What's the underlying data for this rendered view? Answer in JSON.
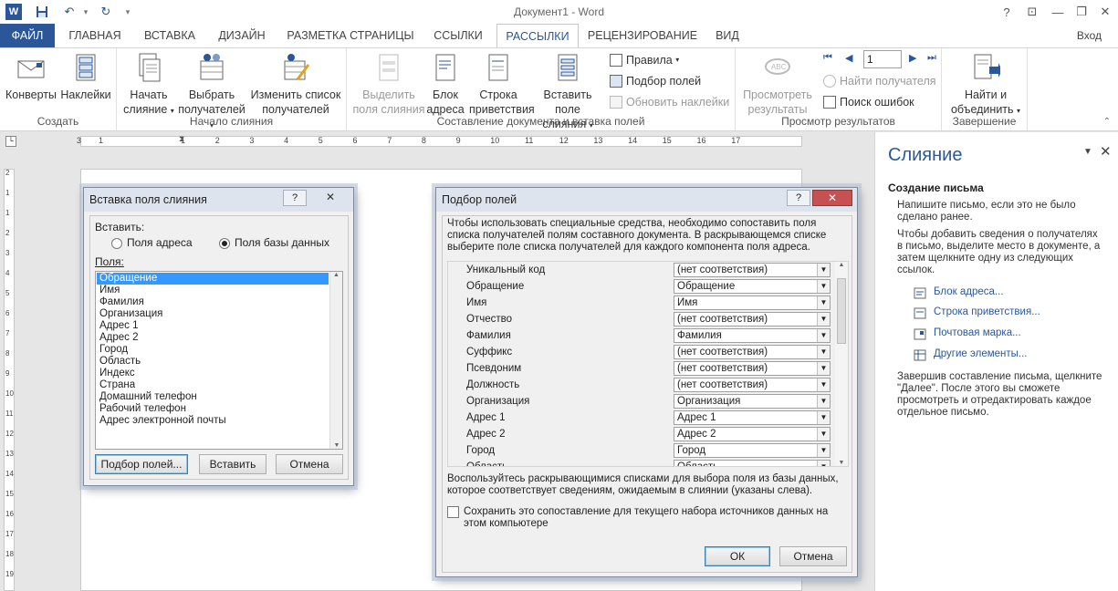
{
  "title_bar": {
    "title": "Документ1 - Word",
    "help": "?",
    "minimize": "—",
    "restore": "❐",
    "close": "✕"
  },
  "tabs": [
    "ФАЙЛ",
    "ГЛАВНАЯ",
    "ВСТАВКА",
    "ДИЗАЙН",
    "РАЗМЕТКА СТРАНИЦЫ",
    "ССЫЛКИ",
    "РАССЫЛКИ",
    "РЕЦЕНЗИРОВАНИЕ",
    "ВИД"
  ],
  "active_tab": "РАССЫЛКИ",
  "signin": "Вход",
  "ribbon": {
    "create": {
      "label": "Создать",
      "envelopes": "Конверты",
      "labels": "Наклейки"
    },
    "start": {
      "label": "Начало слияния",
      "start_l1": "Начать",
      "start_l2": "слияние",
      "select_l1": "Выбрать",
      "select_l2": "получателей",
      "edit_l1": "Изменить список",
      "edit_l2": "получателей"
    },
    "write": {
      "label": "Составление документа и вставка полей",
      "highlight_l1": "Выделить",
      "highlight_l2": "поля слияния",
      "address_l1": "Блок",
      "address_l2": "адреса",
      "greeting_l1": "Строка",
      "greeting_l2": "приветствия",
      "insert_l1": "Вставить поле",
      "insert_l2": "слияния",
      "rules": "Правила",
      "match": "Подбор полей",
      "update": "Обновить наклейки"
    },
    "preview": {
      "label": "Просмотр результатов",
      "preview_l1": "Просмотреть",
      "preview_l2": "результаты",
      "record": "1",
      "find": "Найти получателя",
      "errors": "Поиск ошибок"
    },
    "finish": {
      "label": "Завершение",
      "finish_l1": "Найти и",
      "finish_l2": "объединить"
    }
  },
  "ruler": {
    "ticks": [
      "3",
      "1",
      "1",
      "2",
      "3",
      "4",
      "5",
      "6",
      "7",
      "8",
      "9",
      "10",
      "11",
      "12",
      "13",
      "14",
      "15",
      "16",
      "17"
    ]
  },
  "vruler": {
    "ticks": [
      "2",
      "1",
      "1",
      "2",
      "3",
      "4",
      "5",
      "6",
      "7",
      "8",
      "9",
      "10",
      "11",
      "12",
      "13",
      "14",
      "15",
      "16",
      "17",
      "18",
      "19"
    ]
  },
  "insert_dialog": {
    "title": "Вставка поля слияния",
    "help": "?",
    "close": "✕",
    "insert_label": "Вставить:",
    "radio_address": "Поля адреса",
    "radio_db": "Поля базы данных",
    "fields_label": "Поля:",
    "fields": [
      "Обращение",
      "Имя",
      "Фамилия",
      "Организация",
      "Адрес 1",
      "Адрес 2",
      "Город",
      "Область",
      "Индекс",
      "Страна",
      "Домашний телефон",
      "Рабочий телефон",
      "Адрес электронной почты"
    ],
    "btn_match": "Подбор полей...",
    "btn_insert": "Вставить",
    "btn_cancel": "Отмена"
  },
  "match_dialog": {
    "title": "Подбор полей",
    "help": "?",
    "close": "✕",
    "intro_l1": "Чтобы использовать специальные средства, необходимо сопоставить поля",
    "intro_l2": "списка получателей полям составного документа. В раскрывающемся списке",
    "intro_l3": "выберите поле списка получателей для каждого компонента поля адреса.",
    "rows": [
      {
        "label": "Уникальный код",
        "value": "(нет соответствия)"
      },
      {
        "label": "Обращение",
        "value": "Обращение"
      },
      {
        "label": "Имя",
        "value": "Имя"
      },
      {
        "label": "Отчество",
        "value": "(нет соответствия)"
      },
      {
        "label": "Фамилия",
        "value": "Фамилия"
      },
      {
        "label": "Суффикс",
        "value": "(нет соответствия)"
      },
      {
        "label": "Псевдоним",
        "value": "(нет соответствия)"
      },
      {
        "label": "Должность",
        "value": "(нет соответствия)"
      },
      {
        "label": "Организация",
        "value": "Организация"
      },
      {
        "label": "Адрес 1",
        "value": "Адрес 1"
      },
      {
        "label": "Адрес 2",
        "value": "Адрес 2"
      },
      {
        "label": "Город",
        "value": "Город"
      },
      {
        "label": "Область",
        "value": "Область"
      }
    ],
    "hint_l1": "Воспользуйтесь раскрывающимися списками для выбора поля из базы данных,",
    "hint_l2": "которое соответствует сведениям, ожидаемым в слиянии (указаны слева).",
    "save_l1": "Сохранить это сопоставление для текущего набора источников данных на",
    "save_l2": "этом компьютере",
    "ok": "ОК",
    "cancel": "Отмена"
  },
  "task_pane": {
    "title": "Слияние",
    "section": "Создание письма",
    "p1_l1": "Напишите письмо, если это не было",
    "p1_l2": "сделано ранее.",
    "p2_l1": "Чтобы добавить сведения о получателях",
    "p2_l2": "в письмо, выделите место в документе, а",
    "p2_l3": "затем щелкните одну из следующих",
    "p2_l4": "ссылок.",
    "links": [
      "Блок адреса...",
      "Строка приветствия...",
      "Почтовая марка...",
      "Другие элементы..."
    ],
    "p3_l1": "Завершив составление письма, щелкните",
    "p3_l2": "\"Далее\". После этого вы сможете",
    "p3_l3": "просмотреть и отредактировать каждое",
    "p3_l4": "отдельное письмо."
  },
  "colors": {
    "accent": "#2b579a",
    "selection": "#3399ff",
    "close_red": "#c75050"
  }
}
